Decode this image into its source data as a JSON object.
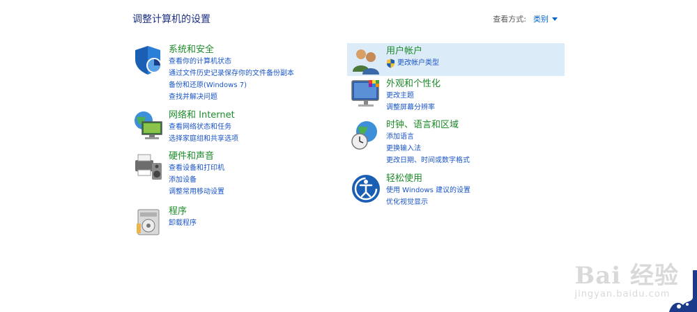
{
  "header": {
    "title": "调整计算机的设置",
    "view_by_label": "查看方式:",
    "view_by_value": "类别"
  },
  "categories": {
    "system": {
      "title": "系统和安全",
      "links": [
        "查看你的计算机状态",
        "通过文件历史记录保存你的文件备份副本",
        "备份和还原(Windows 7)",
        "查找并解决问题"
      ]
    },
    "network": {
      "title": "网络和 Internet",
      "links": [
        "查看网络状态和任务",
        "选择家庭组和共享选项"
      ]
    },
    "hardware": {
      "title": "硬件和声音",
      "links": [
        "查看设备和打印机",
        "添加设备",
        "调整常用移动设置"
      ]
    },
    "programs": {
      "title": "程序",
      "links": [
        "卸载程序"
      ]
    },
    "users": {
      "title": "用户帐户",
      "links": [
        "更改帐户类型"
      ]
    },
    "appearance": {
      "title": "外观和个性化",
      "links": [
        "更改主题",
        "调整屏幕分辨率"
      ]
    },
    "clock": {
      "title": "时钟、语言和区域",
      "links": [
        "添加语言",
        "更换输入法",
        "更改日期、时间或数字格式"
      ]
    },
    "ease": {
      "title": "轻松使用",
      "links": [
        "使用 Windows 建议的设置",
        "优化视觉显示"
      ]
    }
  },
  "watermark": {
    "logo": "Bai 经验",
    "url": "jingyan.baidu.com"
  },
  "colors": {
    "title_blue": "#1e3287",
    "category_green": "#1c8a28",
    "link_blue": "#1a55c8",
    "highlight": "#dcebf8"
  }
}
